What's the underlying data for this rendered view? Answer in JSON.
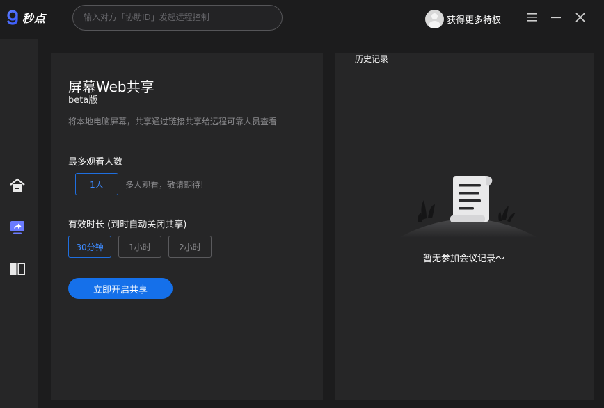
{
  "app": {
    "logo_text": "秒点",
    "brand_color": "#1570ea"
  },
  "search": {
    "placeholder": "输入对方「协助ID」发起远程控制",
    "value": ""
  },
  "user": {
    "label": "获得更多特权"
  },
  "window_controls": {
    "icons": [
      "menu-icon",
      "minimize-icon",
      "close-icon"
    ]
  },
  "sidebar": {
    "items": [
      {
        "icon": "home-icon",
        "active": false
      },
      {
        "icon": "screen-share-icon",
        "active": true
      },
      {
        "icon": "book-icon",
        "active": false
      }
    ]
  },
  "share": {
    "title": "屏幕Web共享",
    "subtitle": "beta版",
    "description": "将本地电脑屏幕，共享通过链接共享给远程可靠人员查看",
    "viewers_label": "最多观看人数",
    "viewers_options": [
      {
        "label": "1人",
        "selected": true
      }
    ],
    "viewers_hint": "多人观看，敬请期待!",
    "duration_label": "有效时长 (到时自动关闭共享)",
    "duration_options": [
      {
        "label": "30分钟",
        "selected": true
      },
      {
        "label": "1小时",
        "selected": false
      },
      {
        "label": "2小时",
        "selected": false
      }
    ],
    "start_button": "立即开启共享"
  },
  "history": {
    "title": "历史记录",
    "empty_text": "暂无参加会议记录～"
  }
}
